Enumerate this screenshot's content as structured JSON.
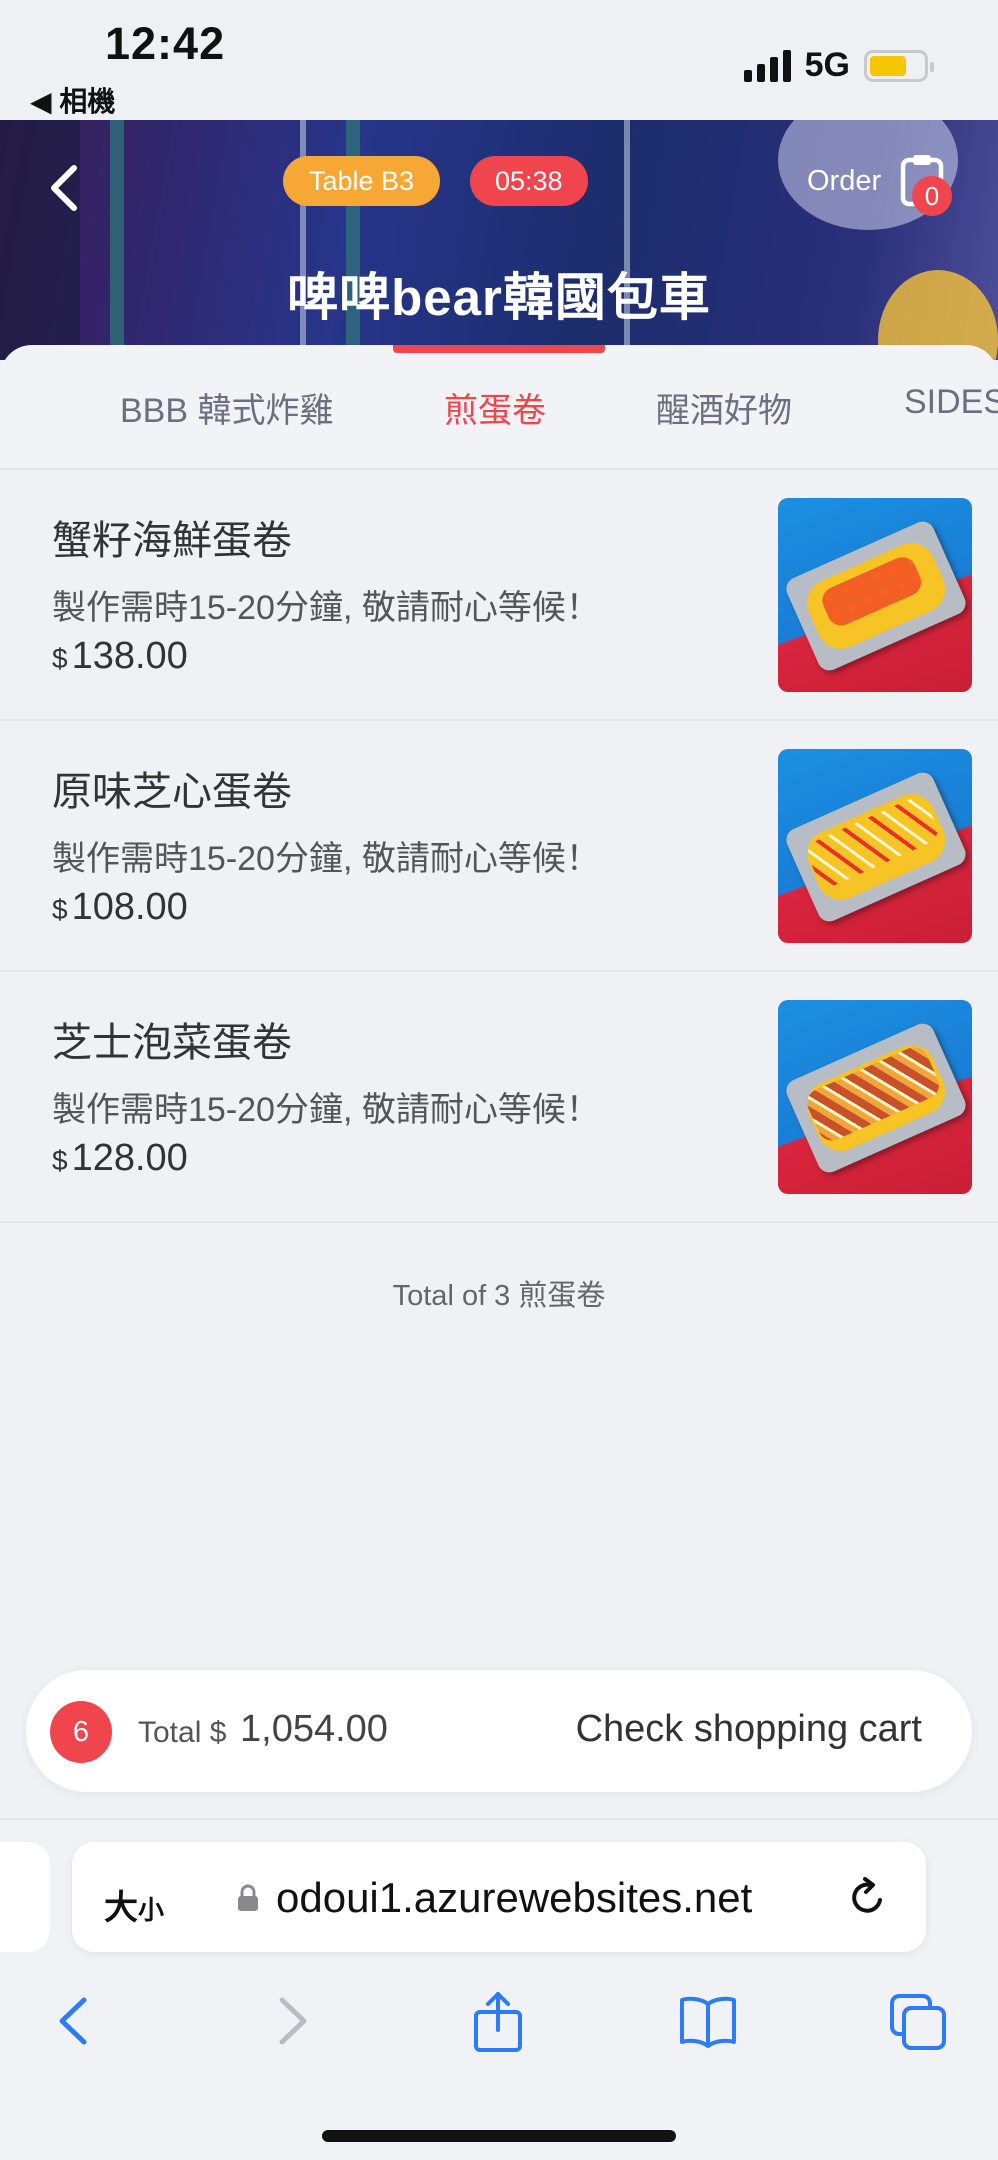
{
  "status_bar": {
    "time": "12:42",
    "back_app": "◀ 相機",
    "network": "5G",
    "battery_color": "#f6c700"
  },
  "header": {
    "table_badge": "Table  B3",
    "timer": "05:38",
    "order_label": "Order",
    "order_count": "0",
    "store_name": "啤啤bear韓國包車",
    "accent_color": "#f0454d"
  },
  "tabs": [
    {
      "label": "BBB 韓式炸雞",
      "active": false
    },
    {
      "label": "煎蛋卷",
      "active": true
    },
    {
      "label": "醒酒好物",
      "active": false
    },
    {
      "label": "SIDES",
      "active": false
    }
  ],
  "menu": {
    "items": [
      {
        "name": "蟹籽海鮮蛋卷",
        "description": "製作需時15-20分鐘, 敬請耐心等候！",
        "currency": "$",
        "price": "138.00"
      },
      {
        "name": "原味芝心蛋卷",
        "description": "製作需時15-20分鐘, 敬請耐心等候！",
        "currency": "$",
        "price": "108.00"
      },
      {
        "name": "芝士泡菜蛋卷",
        "description": "製作需時15-20分鐘, 敬請耐心等候！",
        "currency": "$",
        "price": "128.00"
      }
    ],
    "total_text": "Total of 3 煎蛋卷"
  },
  "cart": {
    "count": "6",
    "total_label": "Total $",
    "total_value": "1,054.00",
    "checkout_label": "Check shopping cart"
  },
  "browser": {
    "text_size_label": "大",
    "text_size_small": "小",
    "url": "odoui1.azurewebsites.net",
    "tint_color": "#2b7cf6"
  }
}
